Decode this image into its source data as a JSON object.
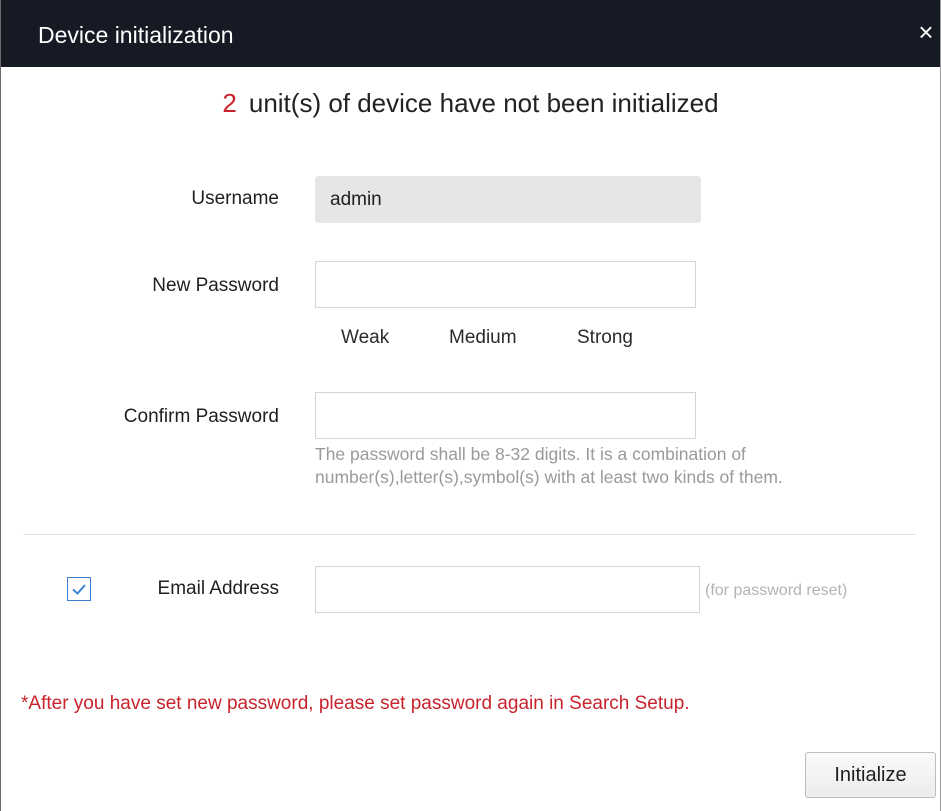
{
  "dialog": {
    "title": "Device initialization",
    "close_icon": "close-icon",
    "close_glyph": "×"
  },
  "header": {
    "count": "2",
    "message": "unit(s) of device have not been initialized",
    "count_color": "#c8232c"
  },
  "form": {
    "username": {
      "label": "Username",
      "value": "admin"
    },
    "new_password": {
      "label": "New Password",
      "value": "",
      "placeholder": ""
    },
    "strength": {
      "weak": "Weak",
      "medium": "Medium",
      "strong": "Strong"
    },
    "confirm_password": {
      "label": "Confirm Password",
      "value": "",
      "placeholder": ""
    },
    "password_hint": "The password shall be 8-32 digits. It is a combination of number(s),letter(s),symbol(s) with at least two kinds of them.",
    "email": {
      "checked": true,
      "label": "Email Address",
      "value": "",
      "placeholder": "",
      "note": "(for password reset)"
    }
  },
  "warning": "*After you have set new password, please set password again in Search Setup.",
  "buttons": {
    "initialize": "Initialize"
  },
  "colors": {
    "titlebar": "#161a24",
    "warning": "#c8232c",
    "checkbox_accent": "#3c82d4"
  }
}
